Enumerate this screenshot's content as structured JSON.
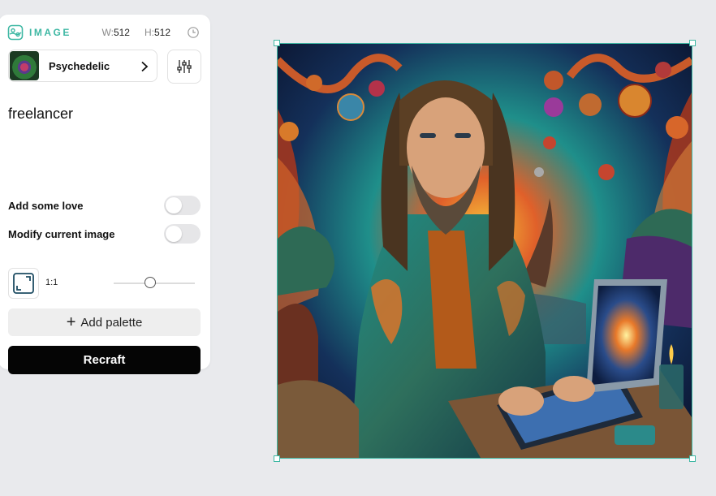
{
  "panel": {
    "type_label": "IMAGE",
    "width_label": "W:",
    "width_value": "512",
    "height_label": "H:",
    "height_value": "512",
    "style": {
      "name": "Psychedelic"
    },
    "prompt": "freelancer",
    "toggles": [
      {
        "label": "Add some love",
        "on": false
      },
      {
        "label": "Modify current image",
        "on": false
      }
    ],
    "aspect_ratio": "1:1",
    "add_palette_label": "Add palette",
    "recraft_label": "Recraft"
  },
  "canvas": {
    "image_subject": "psychedelic illustration of a long-haired bearded man in an ornate teal jacket typing on a laptop, swirling colorful trees, glowing orbs, sunset castle"
  },
  "colors": {
    "accent": "#3fb8a4",
    "background": "#e9eaed",
    "primary_button": "#050505"
  }
}
